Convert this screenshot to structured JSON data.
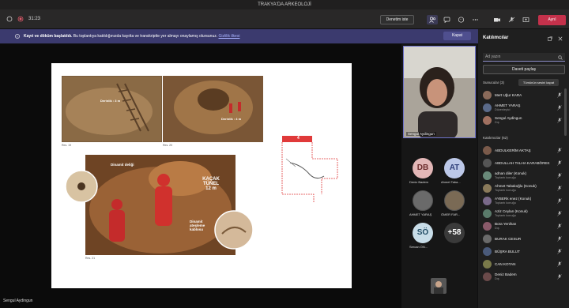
{
  "window": {
    "title": "TRAKYA'DA ARKEOLOJİ"
  },
  "toolbar": {
    "timer": "31:23",
    "layout_button": "Denetim iste",
    "leave_button": "Ayrıl"
  },
  "banner": {
    "bold": "Kayıt ve döküm başlatıldı.",
    "text": "Bu toplantıya katıldığınızda kayıtta ve transkriptte yer almayı onaylamış olursunuz.",
    "link": "Gizlilik ilkesi",
    "button": "Kapat"
  },
  "slide": {
    "caption1": "Res. 19",
    "caption2": "Res. 20",
    "caption3": "Res. 21",
    "depth1": "Derinlik : 3 m",
    "depth2": "Derinlik : 4 m",
    "dinamit_deligi": "Dinamit deliği",
    "kacak_tunel": "KAÇAK TÜNEL 12 m",
    "dinamit_atesleme": "Dinamit ateşleme kablosu",
    "map_number": "4"
  },
  "stage": {
    "presenter_tag": "Sengul Aydingun"
  },
  "rail": {
    "self_name": "Sengul Aydingun",
    "tiles": [
      {
        "initials": "DB",
        "name": "Deniz Badem",
        "color": "#e3b7b7",
        "text_color": "#6b2b2b"
      },
      {
        "initials": "AT",
        "name": "Ahmet Taba...",
        "color": "#bcc8e8",
        "text_color": "#30407a"
      },
      {
        "initials": "",
        "name": "AHMET YARAŞ",
        "color": "#6a6a6a",
        "text_color": "#fff"
      },
      {
        "initials": "",
        "name": "ÖMER FAR...",
        "color": "#7a6a55",
        "text_color": "#fff"
      },
      {
        "initials": "SÖ",
        "name": "Sercan ÖN...",
        "color": "#c8dde8",
        "text_color": "#204b63"
      },
      {
        "initials": "+58",
        "name": "",
        "color": "#3a3a3a",
        "text_color": "#fff"
      }
    ]
  },
  "panel": {
    "title": "Katılımcılar",
    "search_placeholder": "Ad yazın",
    "invite_button": "Daveti paylaş",
    "presenters_label": "Sunucular (3)",
    "mute_all": "Tümünün sesini kapat",
    "attendees_label": "Katılımcılar (62)",
    "presenters": [
      {
        "name": "Mert Uğur KARA",
        "sub": ""
      },
      {
        "name": "AHMET YARAŞ",
        "sub": "Düzenleyici"
      },
      {
        "name": "Sengul Aydingun",
        "sub": "Dış"
      }
    ],
    "attendees": [
      {
        "name": "ABDULKERİM AKTAŞ",
        "sub": ""
      },
      {
        "name": "ABDULLAH TALHA KARABÖREK",
        "sub": ""
      },
      {
        "name": "adnan diler (Konuk)",
        "sub": "Toplantı konuğu"
      },
      {
        "name": "Ahmet Tabakoğlu (Konuk)",
        "sub": "Toplantı konuğu"
      },
      {
        "name": "AYBERk enez (Konuk)",
        "sub": "Toplantı konuğu"
      },
      {
        "name": "Aziz Ceylan (Konuk)",
        "sub": "Toplantı konuğu"
      },
      {
        "name": "Bora Yenihan",
        "sub": "Dış"
      },
      {
        "name": "BURAK CESUR",
        "sub": ""
      },
      {
        "name": "BÜŞRA BULUT",
        "sub": ""
      },
      {
        "name": "CAN KOTAN",
        "sub": ""
      },
      {
        "name": "Deniz Badem",
        "sub": "Dış"
      }
    ]
  }
}
